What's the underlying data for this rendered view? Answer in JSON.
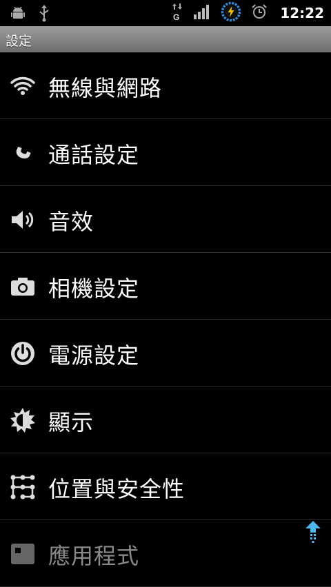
{
  "status_bar": {
    "time": "12:22",
    "left_icons": [
      "android-debug-icon",
      "usb-icon"
    ],
    "right_icons": [
      "data-transfer-g-icon",
      "signal-bars-icon",
      "battery-charging-icon",
      "alarm-clock-icon"
    ],
    "network_type": "G"
  },
  "title_bar": {
    "title": "設定"
  },
  "settings": {
    "items": [
      {
        "label": "無線與網路",
        "icon": "wifi-icon"
      },
      {
        "label": "通話設定",
        "icon": "phone-icon"
      },
      {
        "label": "音效",
        "icon": "speaker-icon"
      },
      {
        "label": "相機設定",
        "icon": "camera-icon"
      },
      {
        "label": "電源設定",
        "icon": "power-icon"
      },
      {
        "label": "顯示",
        "icon": "brightness-icon"
      },
      {
        "label": "位置與安全性",
        "icon": "location-lock-icon"
      },
      {
        "label": "應用程式",
        "icon": "applications-icon"
      }
    ]
  },
  "colors": {
    "background": "#000000",
    "titlebar": "#8a8a8a",
    "accent": "#3aa0e8"
  }
}
